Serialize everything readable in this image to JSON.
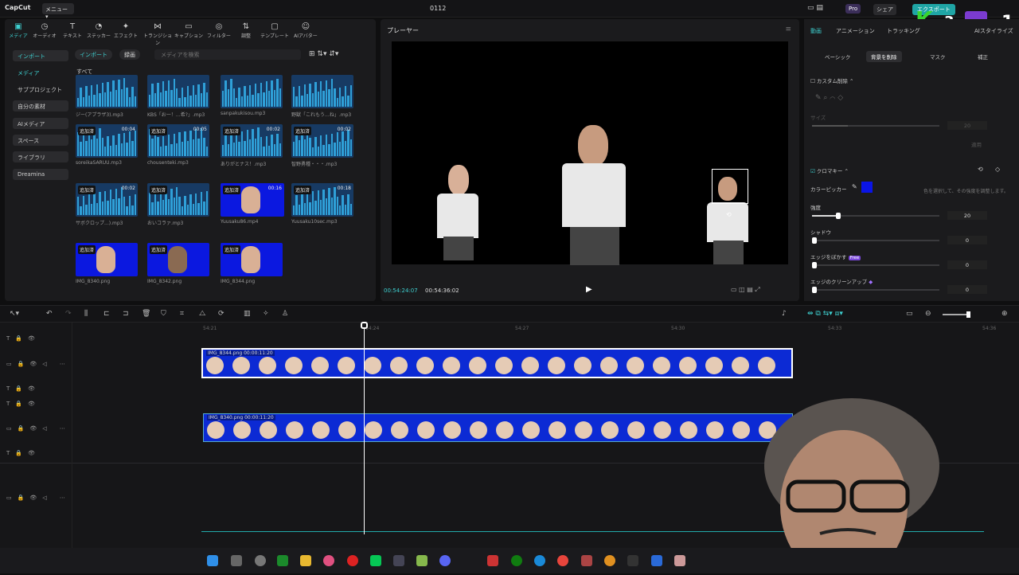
{
  "window": {
    "app_name": "CapCut",
    "menu_label": "メニュー",
    "title": "0112",
    "pro_label": "Pro",
    "share_label": "シェア",
    "export_label": "エクスポート",
    "overlay_k": "K",
    "overlay_3": "3",
    "overlay_1": "1"
  },
  "tool_tabs": [
    {
      "label": "メディア",
      "icon": "media-icon"
    },
    {
      "label": "オーディオ",
      "icon": "audio-icon"
    },
    {
      "label": "テキスト",
      "icon": "text-icon"
    },
    {
      "label": "ステッカー",
      "icon": "sticker-icon"
    },
    {
      "label": "エフェクト",
      "icon": "effect-icon"
    },
    {
      "label": "トランジション",
      "icon": "transition-icon"
    },
    {
      "label": "キャプション",
      "icon": "caption-icon"
    },
    {
      "label": "フィルター",
      "icon": "filter-icon"
    },
    {
      "label": "調整",
      "icon": "adjust-icon"
    },
    {
      "label": "テンプレート",
      "icon": "template-icon"
    },
    {
      "label": "AIアバター",
      "icon": "ai-avatar-icon"
    }
  ],
  "sidebar": [
    {
      "label": "インポート"
    },
    {
      "label": "メディア"
    },
    {
      "label": "サブプロジェクト"
    },
    {
      "label": "自分の素材"
    },
    {
      "label": "AIメディア"
    },
    {
      "label": "スペース"
    },
    {
      "label": "ライブラリ"
    },
    {
      "label": "Dreamina"
    }
  ],
  "media_toolbar": {
    "import_label": "インポート",
    "record_label": "録画",
    "search_placeholder": "メディアを検索",
    "all_label": "すべて"
  },
  "media_items": [
    {
      "name": "ジー(アプラザ3).mp3",
      "type": "audio",
      "added": "",
      "duration": ""
    },
    {
      "name": "KBS「お一！…希?」.mp3",
      "type": "audio",
      "added": "",
      "duration": ""
    },
    {
      "name": "sanpakukisou.mp3",
      "type": "audio",
      "added": "",
      "duration": ""
    },
    {
      "name": "野獣「これもう…ね」.mp3",
      "type": "audio",
      "added": "",
      "duration": ""
    },
    {
      "name": "soreikaSARUU.mp3",
      "type": "audio",
      "added": "追加済",
      "duration": "00:04"
    },
    {
      "name": "chousenteki.mp3",
      "type": "audio",
      "added": "追加済",
      "duration": "00:05"
    },
    {
      "name": "ありがとナス！.mp3",
      "type": "audio",
      "added": "追加済",
      "duration": "00:02"
    },
    {
      "name": "智野勇種・・・.mp3",
      "type": "audio",
      "added": "追加済",
      "duration": "00:02"
    },
    {
      "name": "サボクロップ...).mp3",
      "type": "audio",
      "added": "追加済",
      "duration": "00:02"
    },
    {
      "name": "おいコラァ.mp3",
      "type": "audio",
      "added": "追加済",
      "duration": ""
    },
    {
      "name": "Yuusaku86.mp4",
      "type": "video",
      "added": "追加済",
      "duration": "00:16"
    },
    {
      "name": "Yuusaku10sec.mp3",
      "type": "audio",
      "added": "追加済",
      "duration": "00:18"
    },
    {
      "name": "IMG_8340.png",
      "type": "image",
      "added": "追加済",
      "duration": ""
    },
    {
      "name": "IMG_8342.png",
      "type": "image",
      "added": "追加済",
      "duration": ""
    },
    {
      "name": "IMG_8344.png",
      "type": "image",
      "added": "追加済",
      "duration": ""
    }
  ],
  "player": {
    "title": "プレーヤー",
    "current_time": "00:54:24:07",
    "total_time": "00:54:36:02"
  },
  "properties": {
    "tabs": [
      "動画",
      "アニメーション",
      "トラッキング",
      "AIスタイライズ"
    ],
    "subtabs": [
      "ベーシック",
      "背景を削除",
      "マスク",
      "補正"
    ],
    "custom_remove_label": "カスタム削除",
    "size_label": "サイズ",
    "size_value": "20",
    "apply_label": "適用",
    "chroma_label": "クロマキー",
    "color_picker_label": "カラーピッカー",
    "color_picker_hint": "色を選択して、その強度を調整します。",
    "chroma_color": "#0a14e6",
    "strength_label": "強度",
    "strength_value": "20",
    "shadow_label": "シャドウ",
    "shadow_value": "0",
    "edge_feather_label": "エッジをぼかす",
    "free_badge": "Free",
    "edge_feather_value": "0",
    "edge_cleanup_label": "エッジのクリーンアップ",
    "edge_cleanup_value": "0"
  },
  "timeline": {
    "ruler": [
      "54:21",
      "54:24",
      "54:27",
      "54:30",
      "54:33",
      "54:36"
    ],
    "clips": [
      {
        "label": "IMG_8344.png  00:00:11:20"
      },
      {
        "label": "IMG_8340.png  00:00:11:20"
      }
    ]
  }
}
